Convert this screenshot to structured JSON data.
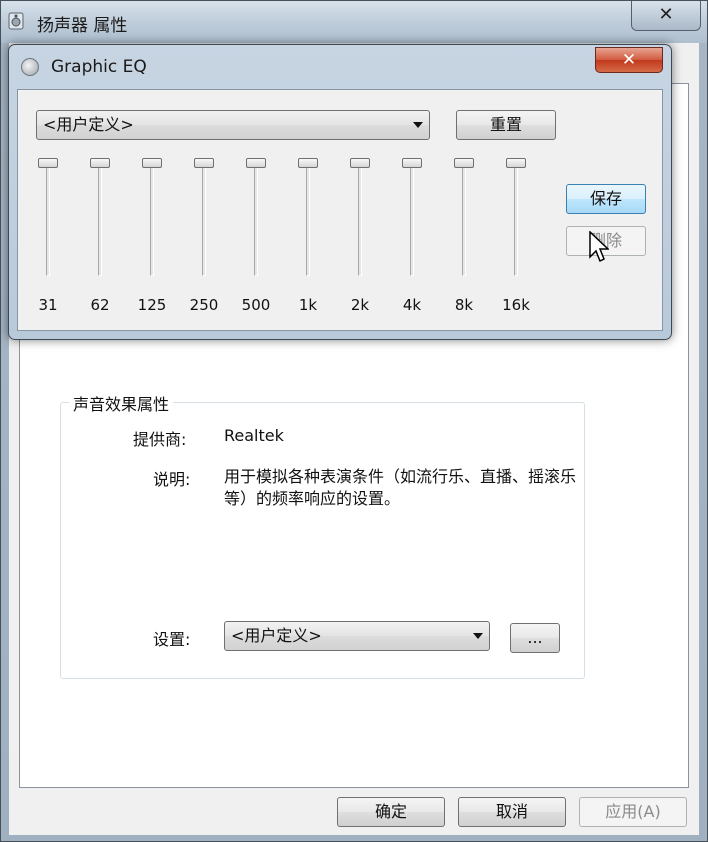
{
  "outer_window": {
    "title": "扬声器 属性",
    "close": "✕",
    "group_title": "声音效果属性",
    "provider_label": "提供商:",
    "provider_value": "Realtek",
    "description_label": "说明:",
    "description_value": "用于模拟各种表演条件（如流行乐、直播、摇滚乐等）的频率响应的设置。",
    "setting_label": "设置:",
    "setting_value": "<用户定义>",
    "more_button": "...",
    "ok_button": "确定",
    "cancel_button": "取消",
    "apply_button": "应用(A)"
  },
  "eq_window": {
    "title": "Graphic EQ",
    "close": "✕",
    "preset_value": "<用户定义>",
    "reset_button": "重置",
    "save_button": "保存",
    "delete_button": "删除",
    "bands": [
      {
        "label": "31",
        "level": 1.0
      },
      {
        "label": "62",
        "level": 1.0
      },
      {
        "label": "125",
        "level": 1.0
      },
      {
        "label": "250",
        "level": 1.0
      },
      {
        "label": "500",
        "level": 1.0
      },
      {
        "label": "1k",
        "level": 1.0
      },
      {
        "label": "2k",
        "level": 1.0
      },
      {
        "label": "4k",
        "level": 1.0
      },
      {
        "label": "8k",
        "level": 1.0
      },
      {
        "label": "16k",
        "level": 1.0
      }
    ]
  }
}
